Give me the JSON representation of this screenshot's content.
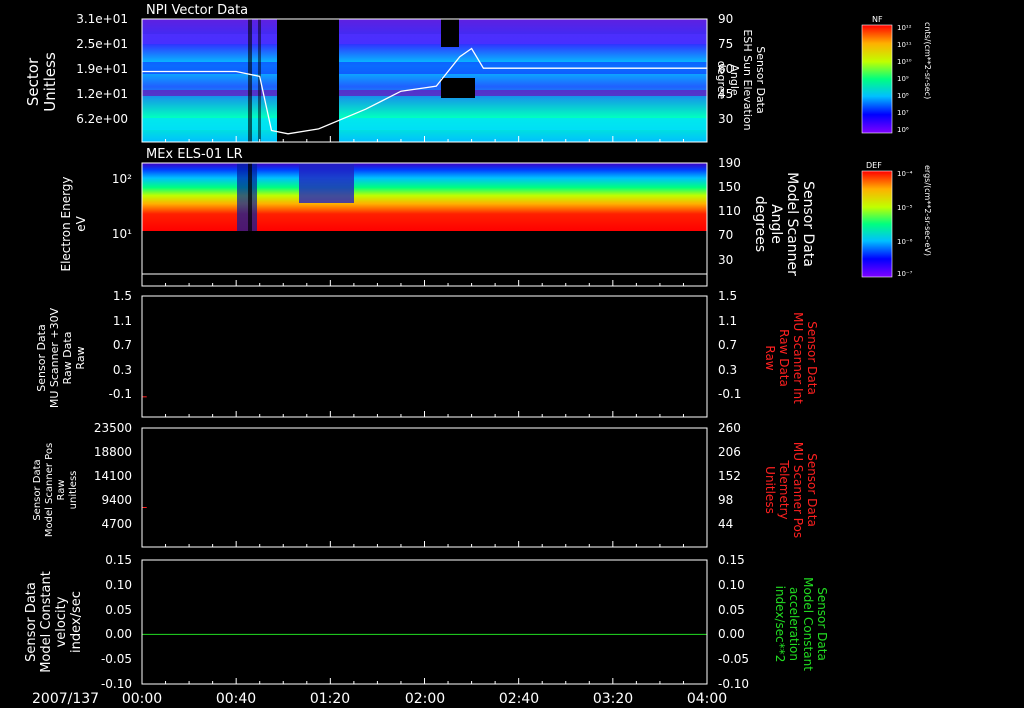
{
  "colors": {
    "text": "#ffffff",
    "red": "#ff2020",
    "green": "#22dd22"
  },
  "footer": {
    "date": "2007/137"
  },
  "time_ticks": [
    "00:00",
    "00:40",
    "01:20",
    "02:00",
    "02:40",
    "03:20",
    "04:00"
  ],
  "colorbars": [
    {
      "label": "NF",
      "unit": "cnts/(cm**2-sr-sec)",
      "tick_labels": [
        "10¹²",
        "10¹¹",
        "10¹⁰",
        "10⁹",
        "10⁸",
        "10⁷",
        "10⁶"
      ]
    },
    {
      "label": "DEF",
      "unit": "ergs/(cm**2-sr-sec-eV)",
      "tick_labels": [
        "10⁻⁴",
        "10⁻⁵",
        "10⁻⁶",
        "10⁻⁷"
      ]
    }
  ],
  "chart_data": [
    {
      "type": "heatmap",
      "title": "NPI Vector Data",
      "ylabel": [
        "Sector",
        "Unitless"
      ],
      "y_ticks": [
        "3.1e+01",
        "2.5e+01",
        "1.9e+01",
        "1.2e+01",
        "6.2e+00"
      ],
      "y2label": [
        "Sensor Data",
        "ESH Sun Elevation",
        "Angle",
        "degree"
      ],
      "y2_ticks": [
        "90",
        "75",
        "60",
        "45",
        "30"
      ],
      "y2lim": [
        15,
        90
      ],
      "overlay_line": {
        "name": "ESH Sun Elevation Angle",
        "x_minutes": [
          0,
          20,
          40,
          50,
          55,
          62,
          75,
          95,
          110,
          120,
          125,
          130,
          135,
          140,
          145,
          160,
          240
        ],
        "values": [
          58,
          58,
          58,
          55,
          22,
          20,
          23,
          35,
          46,
          48,
          49,
          58,
          67,
          72,
          60,
          60,
          60
        ]
      }
    },
    {
      "type": "heatmap",
      "title": "MEx ELS-01 LR",
      "ylabel": [
        "Electron Energy",
        "eV"
      ],
      "y_ticks": [
        "10²",
        "10¹"
      ],
      "y2label": [
        "Sensor Data",
        "Model Scanner",
        "Angle",
        "degrees"
      ],
      "y2_ticks": [
        "190",
        "150",
        "110",
        "70",
        "30"
      ],
      "overlay_value": 10
    },
    {
      "type": "line",
      "ylabel": [
        "Sensor Data",
        "MU Scanner +30V",
        "Raw Data",
        "Raw"
      ],
      "y_ticks": [
        "1.5",
        "1.1",
        "0.7",
        "0.3",
        "-0.1"
      ],
      "y2label": [
        "Sensor Data",
        "MU Scanner Int",
        "Raw Data",
        "Raw"
      ],
      "y2_ticks": [
        "1.5",
        "1.1",
        "0.7",
        "0.3",
        "-0.1"
      ],
      "ylim": [
        -0.3,
        1.5
      ],
      "series": [
        {
          "x_minutes": [
            0,
            2
          ],
          "values": [
            0,
            0
          ]
        }
      ]
    },
    {
      "type": "line",
      "ylabel": [
        "Sensor Data",
        "Model Scanner Pos",
        "Raw",
        "unitless"
      ],
      "y_ticks": [
        "23500",
        "18800",
        "14100",
        "9400",
        "4700"
      ],
      "y2label": [
        "Sensor Data",
        "MU Scanner Pos",
        "Telemetry",
        "Unitless"
      ],
      "y2_ticks": [
        "260",
        "206",
        "152",
        "98",
        "44"
      ],
      "ylim": [
        0,
        23500
      ],
      "series": [
        {
          "x_minutes": [
            0,
            2
          ],
          "values": [
            7800,
            7800
          ]
        }
      ]
    },
    {
      "type": "line",
      "ylabel": [
        "Sensor Data",
        "Model Constant",
        "velocity",
        "index/sec"
      ],
      "y_ticks": [
        "0.15",
        "0.10",
        "0.05",
        "0.00",
        "-0.05",
        "-0.10"
      ],
      "y2label": [
        "Sensor Data",
        "Model Constant",
        "acceleration",
        "index/sec**2"
      ],
      "y2_ticks": [
        "0.15",
        "0.10",
        "0.05",
        "0.00",
        "-0.05",
        "-0.10"
      ],
      "ylim": [
        -0.1,
        0.15
      ],
      "series": [
        {
          "x_minutes": [
            0,
            240
          ],
          "values": [
            0,
            0
          ]
        }
      ]
    }
  ]
}
